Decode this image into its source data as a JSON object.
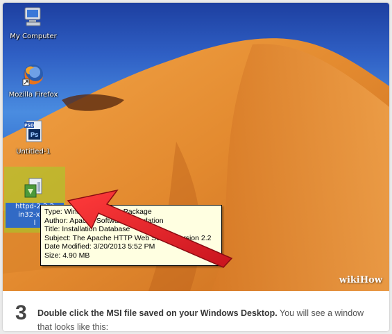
{
  "desktop": {
    "icons": [
      {
        "label": "My Computer",
        "icon": "my-computer-icon"
      },
      {
        "label": "Mozilla Firefox",
        "icon": "firefox-icon"
      },
      {
        "label": "Untitled-1",
        "icon": "psd-file-icon",
        "badge": "PSD",
        "glyph": "Ps"
      }
    ],
    "selected_file": {
      "label": "httpd-2.2.24-win32-x86-no_ssl",
      "visible_label": "httpd-2.2.2\nin32-x86-\nl",
      "icon": "msi-installer-icon"
    }
  },
  "tooltip": {
    "lines": [
      "Type: Windows Installer Package",
      "Author: Apache Software Foundation",
      "Title: Installation Database",
      "Subject: The Apache HTTP Web Server Version 2.2",
      "Date Modified: 3/20/2013 5:52 PM",
      "Size: 4.90 MB"
    ]
  },
  "watermark": "wikiHow",
  "step": {
    "number": "3",
    "bold_text": "Double click the MSI file saved on your Windows Desktop.",
    "rest_text": " You will see a window that looks like this:"
  },
  "colors": {
    "arrow": "#e8202a",
    "selection": "#a0d228",
    "tooltip_bg": "#ffffe1",
    "sand": "#e8902e",
    "sky": "#2d67c8"
  }
}
